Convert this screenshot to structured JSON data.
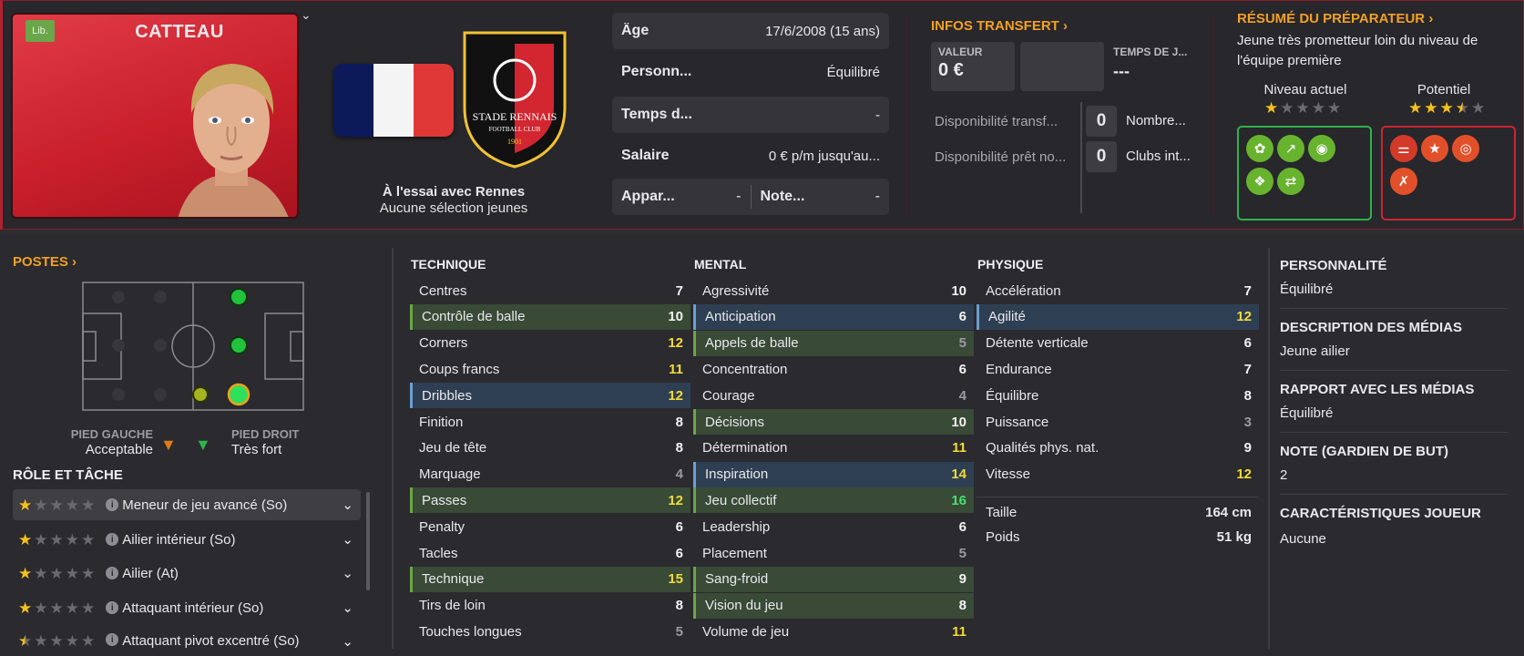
{
  "player": {
    "name": "CATTEAU",
    "badge": "Lib.",
    "club_status": "À l'essai avec Rennes",
    "youth_selection": "Aucune sélection jeunes",
    "club_name_line1": "STADE RENNAIS",
    "club_name_line2": "FOOTBALL CLUB",
    "club_year": "1901"
  },
  "info_rows": [
    {
      "label": "Âge",
      "value": "17/6/2008 (15 ans)"
    },
    {
      "label": "Personn...",
      "value": "Équilibré"
    },
    {
      "label": "Temps d...",
      "value": "-"
    },
    {
      "label": "Salaire",
      "value": "0 € p/m jusqu'au..."
    }
  ],
  "info_split": {
    "left_label": "Appar...",
    "left_value": "-",
    "right_label": "Note...",
    "right_value": "-"
  },
  "transfer": {
    "title": "INFOS TRANSFERT",
    "value_label": "VALEUR",
    "value": "0 €",
    "time_label": "TEMPS DE J...",
    "time_value": "---",
    "transfer_avail_label": "Disponibilité transf...",
    "transfer_avail_value": "0",
    "transfer_avail_right": "Nombre...",
    "loan_avail_label": "Disponibilité prêt no...",
    "loan_avail_value": "0",
    "loan_avail_right": "Clubs int..."
  },
  "coach": {
    "title": "RÉSUMÉ DU PRÉPARATEUR",
    "summary": "Jeune très prometteur loin du niveau de l'équipe première",
    "current_label": "Niveau actuel",
    "potential_label": "Potentiel",
    "current_stars": 1,
    "potential_stars": 3.5
  },
  "positions": {
    "title": "POSTES",
    "left_foot_label": "PIED GAUCHE",
    "left_foot_value": "Acceptable",
    "right_foot_label": "PIED DROIT",
    "right_foot_value": "Très fort"
  },
  "roles": {
    "title": "RÔLE ET TÂCHE",
    "items": [
      {
        "name": "Meneur de jeu avancé (So)",
        "stars": 1
      },
      {
        "name": "Ailier intérieur (So)",
        "stars": 1
      },
      {
        "name": "Ailier (At)",
        "stars": 1
      },
      {
        "name": "Attaquant intérieur (So)",
        "stars": 1
      },
      {
        "name": "Attaquant pivot excentré (So)",
        "stars": 0.5
      }
    ]
  },
  "technique": {
    "title": "TECHNIQUE",
    "rows": [
      {
        "name": "Centres",
        "value": "7",
        "hl": "",
        "c": "w"
      },
      {
        "name": "Contrôle de balle",
        "value": "10",
        "hl": "g",
        "c": "w"
      },
      {
        "name": "Corners",
        "value": "12",
        "hl": "",
        "c": "y"
      },
      {
        "name": "Coups francs",
        "value": "11",
        "hl": "",
        "c": "y"
      },
      {
        "name": "Dribbles",
        "value": "12",
        "hl": "b",
        "c": "y"
      },
      {
        "name": "Finition",
        "value": "8",
        "hl": "",
        "c": "w"
      },
      {
        "name": "Jeu de tête",
        "value": "8",
        "hl": "",
        "c": "w"
      },
      {
        "name": "Marquage",
        "value": "4",
        "hl": "",
        "c": "g"
      },
      {
        "name": "Passes",
        "value": "12",
        "hl": "g",
        "c": "y"
      },
      {
        "name": "Penalty",
        "value": "6",
        "hl": "",
        "c": "w"
      },
      {
        "name": "Tacles",
        "value": "6",
        "hl": "",
        "c": "w"
      },
      {
        "name": "Technique",
        "value": "15",
        "hl": "g",
        "c": "y"
      },
      {
        "name": "Tirs de loin",
        "value": "8",
        "hl": "",
        "c": "w"
      },
      {
        "name": "Touches longues",
        "value": "5",
        "hl": "",
        "c": "g"
      }
    ]
  },
  "mental": {
    "title": "MENTAL",
    "rows": [
      {
        "name": "Agressivité",
        "value": "10",
        "hl": "",
        "c": "w"
      },
      {
        "name": "Anticipation",
        "value": "6",
        "hl": "b",
        "c": "w"
      },
      {
        "name": "Appels de balle",
        "value": "5",
        "hl": "g",
        "c": "g"
      },
      {
        "name": "Concentration",
        "value": "6",
        "hl": "",
        "c": "w"
      },
      {
        "name": "Courage",
        "value": "4",
        "hl": "",
        "c": "g"
      },
      {
        "name": "Décisions",
        "value": "10",
        "hl": "g",
        "c": "w"
      },
      {
        "name": "Détermination",
        "value": "11",
        "hl": "",
        "c": "y"
      },
      {
        "name": "Inspiration",
        "value": "14",
        "hl": "b",
        "c": "y"
      },
      {
        "name": "Jeu collectif",
        "value": "16",
        "hl": "g",
        "c": "gr"
      },
      {
        "name": "Leadership",
        "value": "6",
        "hl": "",
        "c": "w"
      },
      {
        "name": "Placement",
        "value": "5",
        "hl": "",
        "c": "g"
      },
      {
        "name": "Sang-froid",
        "value": "9",
        "hl": "g",
        "c": "w"
      },
      {
        "name": "Vision du jeu",
        "value": "8",
        "hl": "g",
        "c": "w"
      },
      {
        "name": "Volume de jeu",
        "value": "11",
        "hl": "",
        "c": "y"
      }
    ]
  },
  "physique": {
    "title": "PHYSIQUE",
    "rows": [
      {
        "name": "Accélération",
        "value": "7",
        "hl": "",
        "c": "w"
      },
      {
        "name": "Agilité",
        "value": "12",
        "hl": "b",
        "c": "y"
      },
      {
        "name": "Détente verticale",
        "value": "6",
        "hl": "",
        "c": "w"
      },
      {
        "name": "Endurance",
        "value": "7",
        "hl": "",
        "c": "w"
      },
      {
        "name": "Équilibre",
        "value": "8",
        "hl": "",
        "c": "w"
      },
      {
        "name": "Puissance",
        "value": "3",
        "hl": "",
        "c": "g"
      },
      {
        "name": "Qualités phys. nat.",
        "value": "9",
        "hl": "",
        "c": "w"
      },
      {
        "name": "Vitesse",
        "value": "12",
        "hl": "",
        "c": "y"
      }
    ],
    "height_label": "Taille",
    "height_value": "164 cm",
    "weight_label": "Poids",
    "weight_value": "51 kg"
  },
  "right_panel": [
    {
      "title": "PERSONNALITÉ",
      "value": "Équilibré"
    },
    {
      "title": "DESCRIPTION DES MÉDIAS",
      "value": "Jeune ailier"
    },
    {
      "title": "RAPPORT AVEC LES MÉDIAS",
      "value": "Équilibré"
    },
    {
      "title": "NOTE (GARDIEN DE BUT)",
      "value": "2"
    },
    {
      "title": "CARACTÉRISTIQUES JOUEUR",
      "value": "Aucune"
    }
  ],
  "colors": {
    "accent_orange": "#f2a024",
    "club_red": "#d22631",
    "highlight_green": "#394a37",
    "highlight_blue": "#2f3f53",
    "value_yellow": "#f2dc3a",
    "value_green": "#49e070"
  }
}
